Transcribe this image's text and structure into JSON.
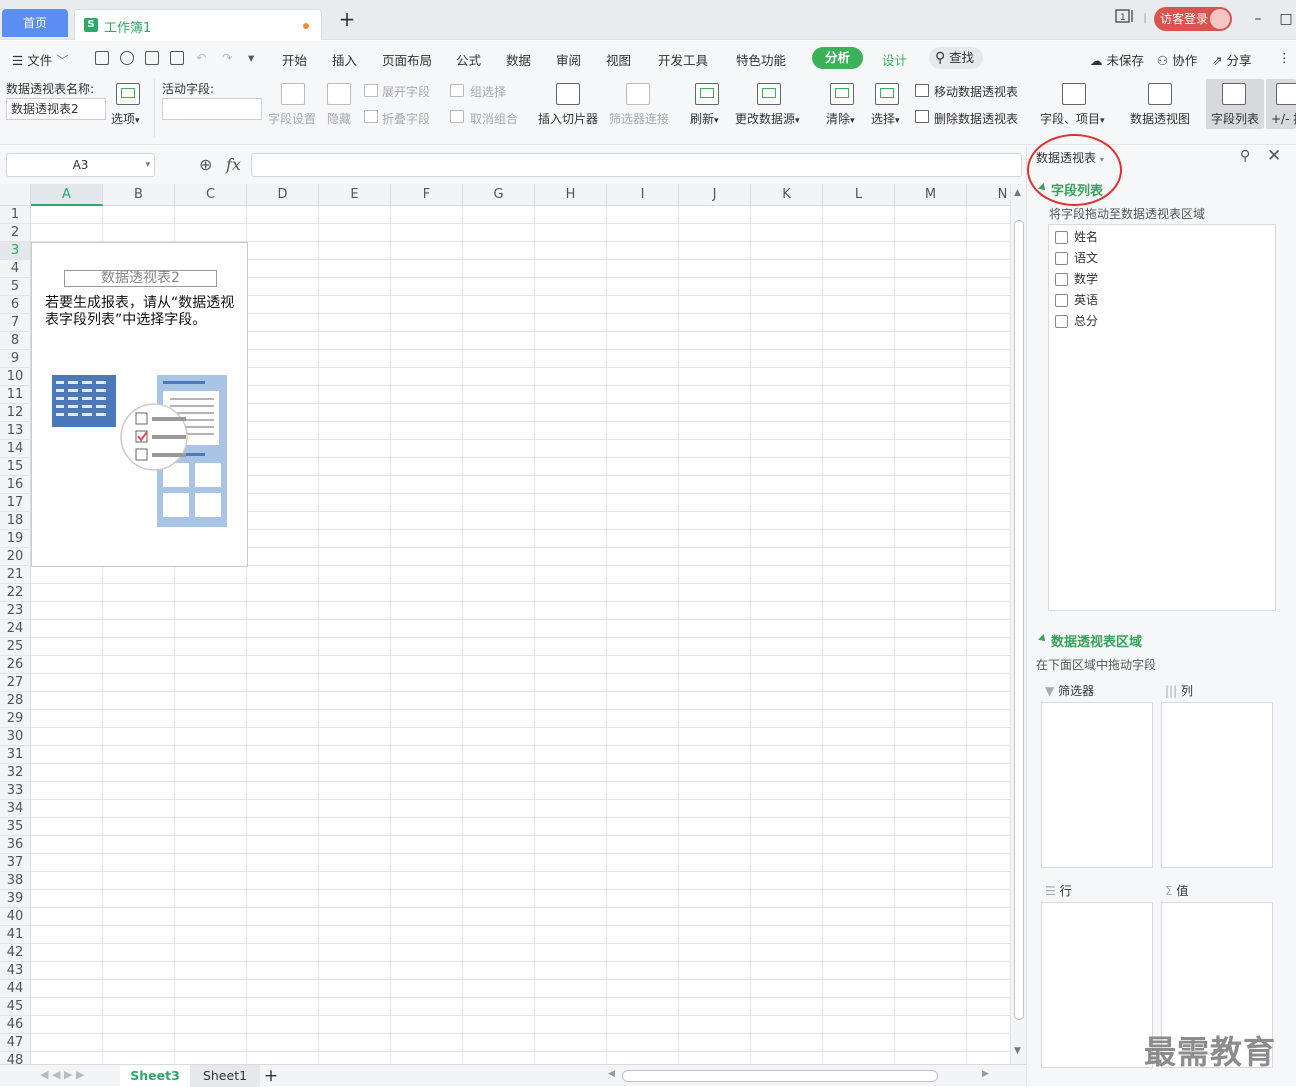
{
  "tabs": {
    "home": "首页",
    "doc": "工作簿1"
  },
  "titlebar": {
    "login": "访客登录"
  },
  "menu": {
    "file": "文件",
    "items": [
      "开始",
      "插入",
      "页面布局",
      "公式",
      "数据",
      "审阅",
      "视图",
      "开发工具",
      "特色功能"
    ],
    "analysis": "分析",
    "design": "设计",
    "search": "查找",
    "unsaved": "未保存",
    "collab": "协作",
    "share": "分享"
  },
  "ribbon": {
    "pivot_name_label": "数据透视表名称:",
    "pivot_name_value": "数据透视表2",
    "options": "选项",
    "active_field_label": "活动字段:",
    "field_settings": "字段设置",
    "hide": "隐藏",
    "expand_field": "展开字段",
    "collapse_field": "折叠字段",
    "group_select": "组选择",
    "ungroup": "取消组合",
    "insert_slicer": "插入切片器",
    "filter_connect": "筛选器连接",
    "refresh": "刷新",
    "change_source": "更改数据源",
    "clear": "清除",
    "select": "选择",
    "move_pivot": "移动数据透视表",
    "delete_pivot": "删除数据透视表",
    "fields_items": "字段、项目",
    "pivot_chart": "数据透视图",
    "field_list": "字段列表",
    "plus_minus": "+/- 按"
  },
  "formula": {
    "cell_ref": "A3",
    "fx": "fx"
  },
  "grid": {
    "columns": [
      "A",
      "B",
      "C",
      "D",
      "E",
      "F",
      "G",
      "H",
      "I",
      "J",
      "K",
      "L",
      "M",
      "N"
    ],
    "rows": [
      "1",
      "2",
      "3",
      "4",
      "5",
      "6",
      "7",
      "8",
      "9",
      "10",
      "11",
      "12",
      "13",
      "14",
      "15",
      "16",
      "17",
      "18",
      "19",
      "20",
      "21",
      "22",
      "23",
      "24",
      "25",
      "26",
      "27",
      "28",
      "29",
      "30",
      "31",
      "32",
      "33",
      "34",
      "35",
      "36",
      "37",
      "38",
      "39",
      "40",
      "41",
      "42",
      "43",
      "44",
      "45",
      "46",
      "47",
      "48"
    ]
  },
  "pivot": {
    "name": "数据透视表2",
    "hint": "若要生成报表，请从“数据透视表字段列表”中选择字段。"
  },
  "sheets": [
    "Sheet3",
    "Sheet1"
  ],
  "panel": {
    "title": "数据透视表",
    "field_list_title": "字段列表",
    "field_list_hint": "将字段拖动至数据透视表区域",
    "fields": [
      "姓名",
      "语文",
      "数学",
      "英语",
      "总分"
    ],
    "areas_title": "数据透视表区域",
    "areas_hint": "在下面区域中拖动字段",
    "filter": "筛选器",
    "column": "列",
    "row": "行",
    "value": "值"
  },
  "watermark": "最需教育",
  "colors": {
    "accent": "#2ba86a",
    "tab_blue": "#5b8ef0",
    "login_red": "#d9534f",
    "annotation": "#e03030"
  }
}
